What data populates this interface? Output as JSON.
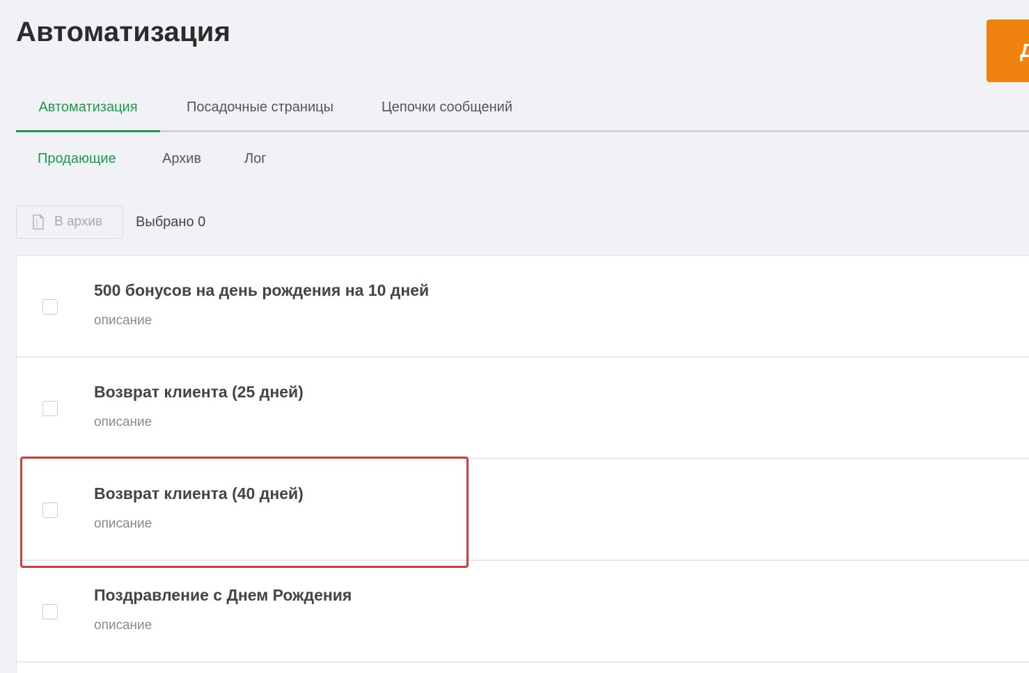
{
  "page": {
    "title": "Автоматизация",
    "primary_action_label": "Д"
  },
  "main_tabs": [
    {
      "label": "Автоматизация",
      "active": true
    },
    {
      "label": "Посадочные страницы",
      "active": false
    },
    {
      "label": "Цепочки сообщений",
      "active": false
    }
  ],
  "sub_tabs": [
    {
      "label": "Продающие",
      "active": true
    },
    {
      "label": "Архив",
      "active": false
    },
    {
      "label": "Лог",
      "active": false
    }
  ],
  "toolbar": {
    "archive_label": "В архив",
    "archive_icon": "document-icon",
    "selected_label": "Выбрано 0"
  },
  "items": [
    {
      "title": "500 бонусов на день рождения на 10 дней",
      "description": "описание",
      "checked": false
    },
    {
      "title": "Возврат клиента (25 дней)",
      "description": "описание",
      "checked": false
    },
    {
      "title": "Возврат клиента (40 дней)",
      "description": "описание",
      "checked": false,
      "highlighted": true
    },
    {
      "title": "Поздравление с Днем Рождения",
      "description": "описание",
      "checked": false
    }
  ],
  "colors": {
    "accent": "#1e9a4f",
    "primary_button": "#f0830f",
    "highlight": "#d93a3a",
    "background": "#f1f2f6"
  }
}
